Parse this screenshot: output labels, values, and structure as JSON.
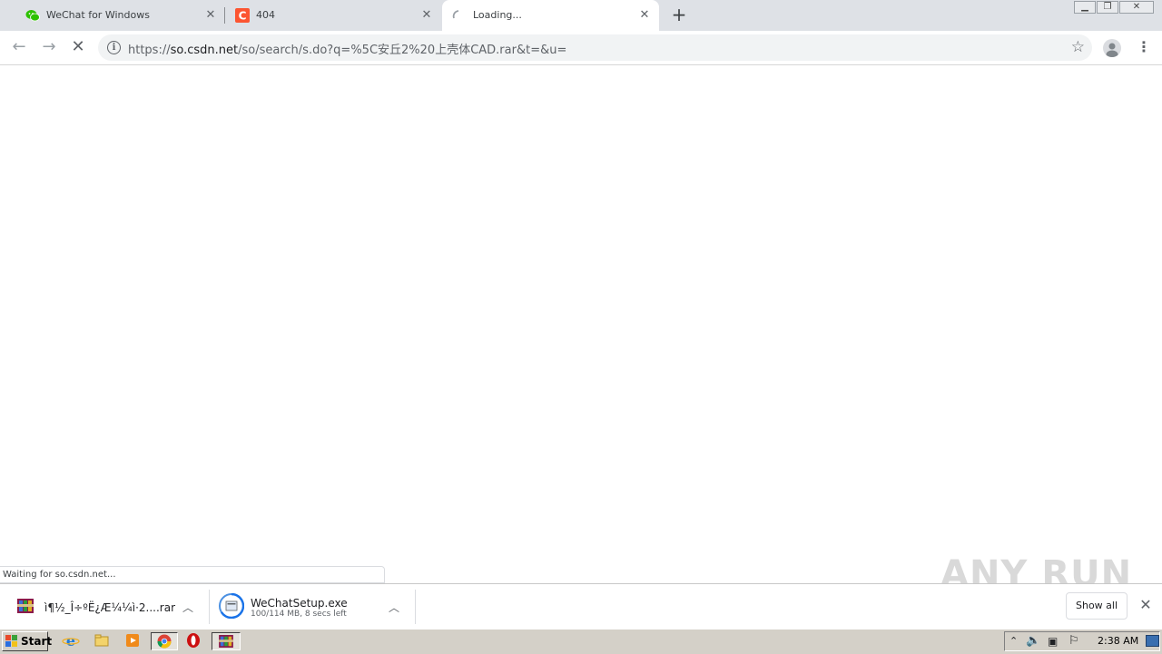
{
  "tabs": [
    {
      "title": "WeChat for Windows",
      "favicon": "wechat-icon",
      "active": false
    },
    {
      "title": "404",
      "favicon": "csdn-icon",
      "active": false
    },
    {
      "title": "Loading...",
      "favicon": "loading-spinner-icon",
      "active": true
    }
  ],
  "toolbar": {
    "url_prefix": "https://",
    "url_host": "so.csdn.net",
    "url_rest": "/so/search/s.do?q=%5C安丘2%20上壳体CAD.rar&t=&u="
  },
  "status": {
    "text": "Waiting for so.csdn.net..."
  },
  "downloads": [
    {
      "name": "ì¶½_Î÷ºË¿Æ¼¼ì·2....rar",
      "sub": "",
      "icon": "winrar-icon"
    },
    {
      "name": "WeChatSetup.exe",
      "sub": "100/114 MB, 8 secs left",
      "icon": "installer-icon"
    }
  ],
  "shelf": {
    "show_all_label": "Show all"
  },
  "watermark": {
    "text": "ANY RUN"
  },
  "taskbar": {
    "start_label": "Start",
    "clock": "2:38 AM"
  },
  "colors": {
    "csdn_red": "#fc5531",
    "wechat_green": "#2dc100",
    "chrome_frame": "#dee1e6"
  }
}
